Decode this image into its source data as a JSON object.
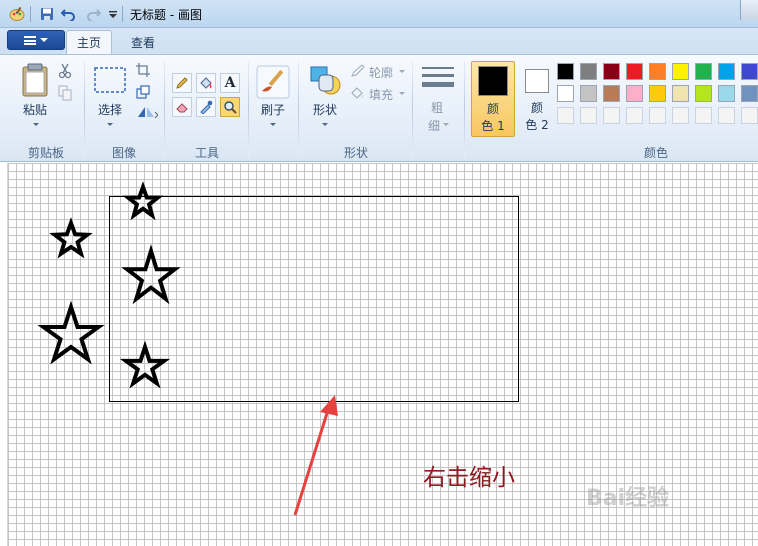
{
  "window": {
    "title": "无标题 - 画图"
  },
  "tabs": [
    {
      "label": "主页",
      "active": true
    },
    {
      "label": "查看",
      "active": false
    }
  ],
  "ribbon": {
    "clipboard": {
      "paste_label": "粘贴",
      "group_label": "剪贴板"
    },
    "image": {
      "select_label": "选择",
      "group_label": "图像"
    },
    "tools": {
      "group_label": "工具"
    },
    "brushes": {
      "label": "刷子"
    },
    "shapes": {
      "shapes_label": "形状",
      "outline_label": "轮廓",
      "fill_label": "填充",
      "group_label": "形状"
    },
    "size": {
      "label_1": "粗",
      "label_2": "细"
    },
    "colors": {
      "color1_label_1": "颜",
      "color1_label_2": "色 1",
      "color2_label_1": "颜",
      "color2_label_2": "色 2",
      "group_label": "颜色",
      "color1_value": "#000000",
      "color2_value": "#ffffff",
      "palette_row1": [
        "#000000",
        "#7f7f7f",
        "#880015",
        "#ed1c24",
        "#ff7f27",
        "#fff200",
        "#22b14c",
        "#00a2e8",
        "#3f48cc",
        "#a349a4"
      ],
      "palette_row2": [
        "#ffffff",
        "#c3c3c3",
        "#b97a57",
        "#ffaec9",
        "#ffc90e",
        "#efe4b0",
        "#b5e61d",
        "#99d9ea",
        "#7092be",
        "#c8bfe7"
      ],
      "palette_row3": [
        "#f4f4f4",
        "#f4f4f4",
        "#f4f4f4",
        "#f4f4f4",
        "#f4f4f4",
        "#f4f4f4",
        "#f4f4f4",
        "#f4f4f4",
        "#f4f4f4",
        "#f4f4f4"
      ]
    }
  },
  "canvas": {
    "annotation": "右击缩小",
    "watermark": "Bai经验",
    "accent_red": "#e8413f"
  }
}
